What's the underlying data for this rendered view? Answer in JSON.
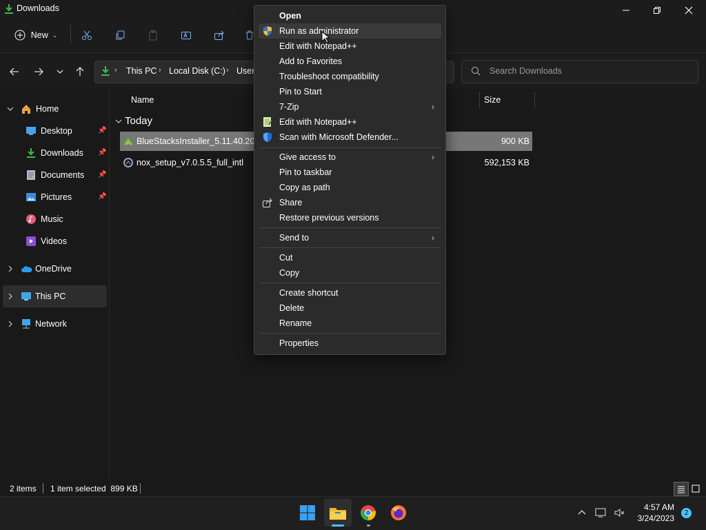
{
  "window": {
    "title": "Downloads"
  },
  "toolbar": {
    "new_label": "New"
  },
  "address": {
    "crumbs": [
      "This PC",
      "Local Disk (C:)",
      "Users"
    ],
    "search_placeholder": "Search Downloads"
  },
  "nav": {
    "home": "Home",
    "desktop": "Desktop",
    "downloads": "Downloads",
    "documents": "Documents",
    "pictures": "Pictures",
    "music": "Music",
    "videos": "Videos",
    "onedrive": "OneDrive",
    "thispc": "This PC",
    "network": "Network"
  },
  "files": {
    "col_name": "Name",
    "col_size": "Size",
    "group": "Today",
    "rows": [
      {
        "name": "BlueStacksInstaller_5.11.40.2001_",
        "size": "900 KB"
      },
      {
        "name": "nox_setup_v7.0.5.5_full_intl",
        "size": "592,153 KB"
      }
    ]
  },
  "context_menu": {
    "items": [
      "Open",
      "Run as administrator",
      "Edit with Notepad++",
      "Add to Favorites",
      "Troubleshoot compatibility",
      "Pin to Start",
      "7-Zip",
      "Edit with Notepad++",
      "Scan with Microsoft Defender...",
      "Give access to",
      "Pin to taskbar",
      "Copy as path",
      "Share",
      "Restore previous versions",
      "Send to",
      "Cut",
      "Copy",
      "Create shortcut",
      "Delete",
      "Rename",
      "Properties"
    ]
  },
  "status": {
    "item_count": "2 items",
    "selection": "1 item selected  899 KB"
  },
  "taskbar": {
    "time": "4:57 AM",
    "date": "3/24/2023",
    "notification_count": "2"
  },
  "colors": {
    "accent": "#4cc2ff",
    "selected_row": "#777777",
    "menu_bg": "#2b2b2b"
  }
}
